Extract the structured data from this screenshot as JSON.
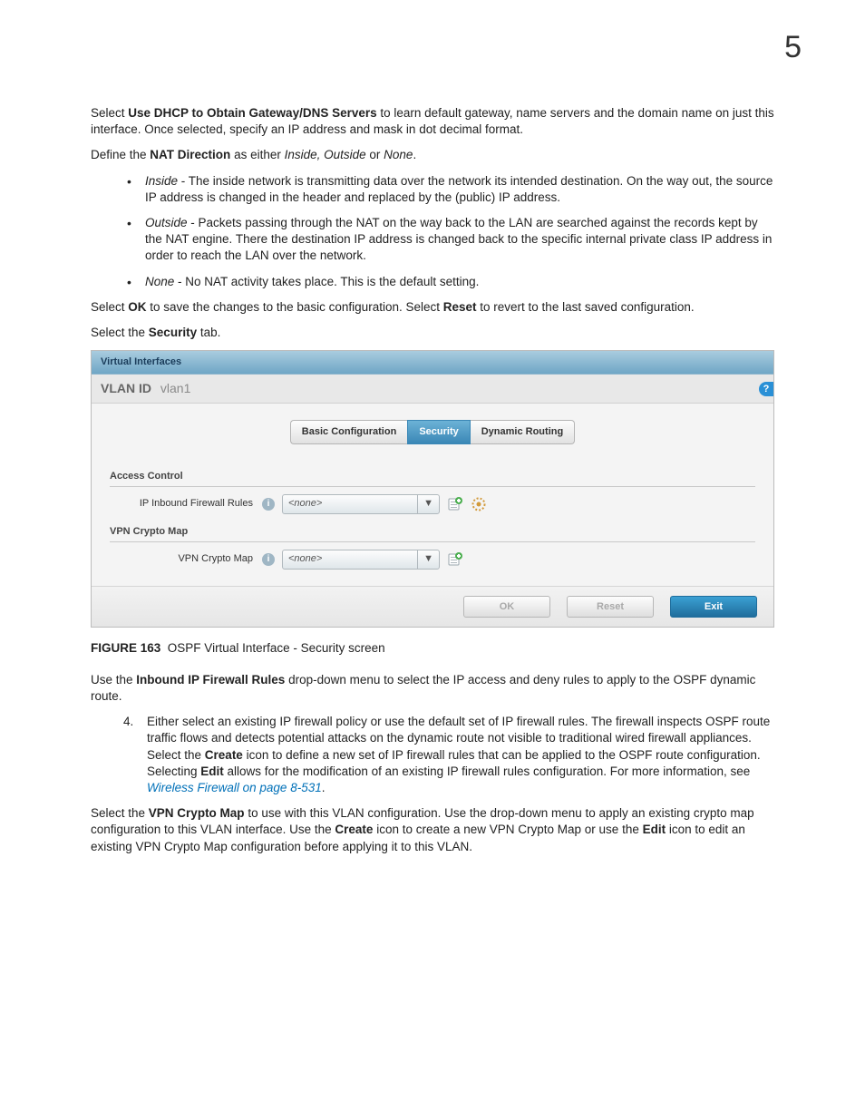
{
  "page": {
    "number": "5"
  },
  "para1": {
    "pre": "Select ",
    "bold": "Use DHCP to Obtain Gateway/DNS Servers",
    "post": " to learn default gateway, name servers and the domain name on just this interface. Once selected, specify an IP address and mask in dot decimal format."
  },
  "para2": {
    "pre": "Define the ",
    "bold": "NAT Direction",
    "post1": " as either ",
    "it": "Inside, Outside",
    "post2": " or ",
    "it2": "None",
    "post3": "."
  },
  "bullets": [
    {
      "term": "Inside",
      "text": " - The inside network is transmitting data over the network its intended destination. On the way out, the source IP address is changed in the header and replaced by the (public) IP address."
    },
    {
      "term": "Outside",
      "text": " - Packets passing through the NAT on the way back to the LAN are searched against the records kept by the NAT engine. There the destination IP address is changed back to the specific internal private class IP address in order to reach the LAN over the network."
    },
    {
      "term": "None",
      "text": " - No NAT activity takes place. This is the default setting."
    }
  ],
  "para3": {
    "pre": "Select ",
    "b1": "OK",
    "mid": " to save the changes to the basic configuration. Select ",
    "b2": "Reset",
    "post": " to revert to the last saved configuration."
  },
  "para4": {
    "pre": "Select the ",
    "b": "Security",
    "post": " tab."
  },
  "panel": {
    "title": "Virtual Interfaces",
    "vlabel": "VLAN ID",
    "vval": "vlan1",
    "tabs": {
      "t1": "Basic Configuration",
      "t2": "Security",
      "t3": "Dynamic Routing"
    },
    "sect1": "Access Control",
    "field1": {
      "label": "IP Inbound Firewall Rules",
      "value": "<none>"
    },
    "sect2": "VPN Crypto Map",
    "field2": {
      "label": "VPN Crypto Map",
      "value": "<none>"
    },
    "buttons": {
      "ok": "OK",
      "reset": "Reset",
      "exit": "Exit"
    }
  },
  "figcap": {
    "label": "FIGURE 163",
    "text": "OSPF Virtual Interface - Security screen"
  },
  "para5": {
    "pre": "Use the ",
    "b": "Inbound IP Firewall Rules",
    "post": " drop-down menu to select the IP access and deny rules to apply to the OSPF dynamic route."
  },
  "ol4": {
    "n": "4.",
    "t1": "Either select an existing IP firewall policy or use the default set of IP firewall rules. The firewall inspects OSPF route traffic flows and detects potential attacks on the dynamic route not visible to traditional wired firewall appliances. Select the ",
    "b1": "Create",
    "t2": " icon to define a new set of IP firewall rules that can be applied to the OSPF route configuration. Selecting ",
    "b2": "Edit",
    "t3": " allows for the modification of an existing IP firewall rules configuration. For more information, see ",
    "link": "Wireless Firewall on page 8-531",
    "t4": "."
  },
  "para6": {
    "pre": "Select the ",
    "b1": "VPN Crypto Map",
    "t1": " to use with this VLAN configuration. Use the drop-down menu to apply an existing crypto map configuration to this VLAN interface. Use the ",
    "b2": "Create",
    "t2": " icon to create a new VPN Crypto Map or use the ",
    "b3": "Edit",
    "t3": " icon to edit an existing VPN Crypto Map configuration before applying it to this VLAN."
  }
}
